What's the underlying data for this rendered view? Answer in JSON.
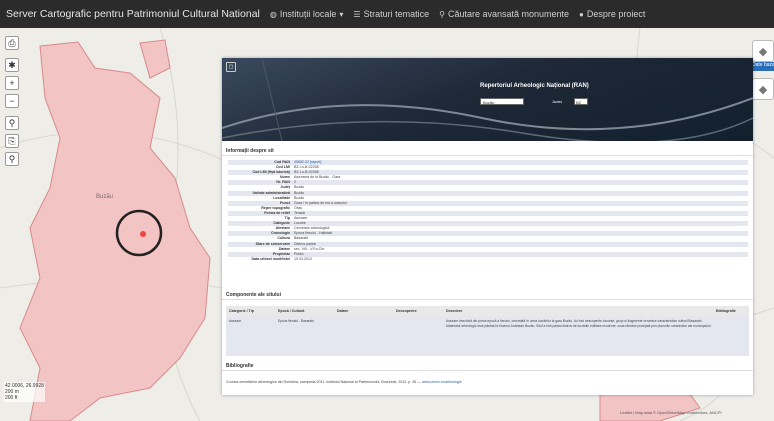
{
  "app": {
    "title": "Server Cartografic pentru Patrimoniul Cultural National",
    "nav": [
      {
        "icon": "globe-icon",
        "label": "Instituții locale"
      },
      {
        "icon": "list-icon",
        "label": "Straturi tematice"
      },
      {
        "icon": "search-icon",
        "label": "Căutare avansată monumente"
      },
      {
        "icon": "info-icon",
        "label": "Despre proiect"
      }
    ]
  },
  "map": {
    "town_label": "Buzău",
    "scale": {
      "line1": "42.0006, 26.9928",
      "line2": "200 m",
      "line3": "200 ft"
    },
    "attribution": "Leaflet | Map data © OpenStreetMap contributors, ANCPI"
  },
  "tools": {
    "print": "⎙",
    "pin": "✱",
    "zoom_in": "+",
    "zoom_out": "−",
    "locate": "⚲",
    "bookmark": "⎘",
    "search": "⚲"
  },
  "right": {
    "layer1": "◆",
    "tip": "Date baza",
    "layer2": "◆"
  },
  "panel": {
    "banner_title": "Repertoriul Arheologic Național (RAN)",
    "search_value": "Buzău",
    "search_label": "Județ",
    "search_select": "BZ",
    "info_title": "Informații despre sit",
    "fields": [
      {
        "k": "Cod RAN",
        "v": "45682.02 [raport]"
      },
      {
        "k": "Cod LMI",
        "v": "BZ-I-s-B-02258"
      },
      {
        "k": "Cod LMI (fișă istorică)",
        "v": "BZ-I-s-B-02258"
      },
      {
        "k": "Nume",
        "v": "Așezarea de la Buzău - Gara"
      },
      {
        "k": "Nr. RAN",
        "v": "2"
      },
      {
        "k": "Județ",
        "v": "Buzău"
      },
      {
        "k": "Unitate administrativă",
        "v": "Buzău"
      },
      {
        "k": "Localitate",
        "v": "Buzău"
      },
      {
        "k": "Punct",
        "v": "Gara / în partea de est a orașului"
      },
      {
        "k": "Reper topografic",
        "v": "Oraș"
      },
      {
        "k": "Forma de relief",
        "v": "Terasă"
      },
      {
        "k": "Tip",
        "v": "Așezare"
      },
      {
        "k": "Categorie",
        "v": "Locuire"
      },
      {
        "k": "Atestare",
        "v": "Cercetare arheologică"
      },
      {
        "k": "Cronologie",
        "v": "Epoca fierului - Hallstatt"
      },
      {
        "k": "Cultura",
        "v": "Basarabi"
      },
      {
        "k": "Stare de conservare",
        "v": "Distrus parțial"
      },
      {
        "k": "Datare",
        "v": "sec. VIII - VII a.Chr."
      },
      {
        "k": "Proprietar",
        "v": "Public"
      },
      {
        "k": "Data ultimei modificări",
        "v": "19.03.2012"
      }
    ],
    "comp_title": "Componente ale sitului",
    "comp_headers": [
      "Categorie / Tip",
      "Epocă / Cultură",
      "Datare",
      "Descoperire",
      "Descriere",
      "Bibliografie"
    ],
    "comp_row": [
      "Așezare",
      "Epoca fierului - Basarabi",
      "",
      "",
      "Așezare deschisă din prima epocă a fierului, cercetată în urma lucrărilor la gara Buzău. Au fost descoperite locuințe, gropi și fragmente ceramice caracteristice culturii Basarabi. Materialul arheologic este păstrat la Muzeul Județean Buzău. Situl a fost parțial distrus de lucrările edilitare moderne; zona rămâne protejată prin planurile urbanistice ale municipiului.",
      ""
    ],
    "biblio_title": "Bibliografie",
    "biblio_text": "Cronica cercetărilor arheologice din România, campania 2011. Institutul Național al Patrimoniului, București, 2012, p. 45 —",
    "biblio_link": "www.cimec.ro/arheologie"
  }
}
